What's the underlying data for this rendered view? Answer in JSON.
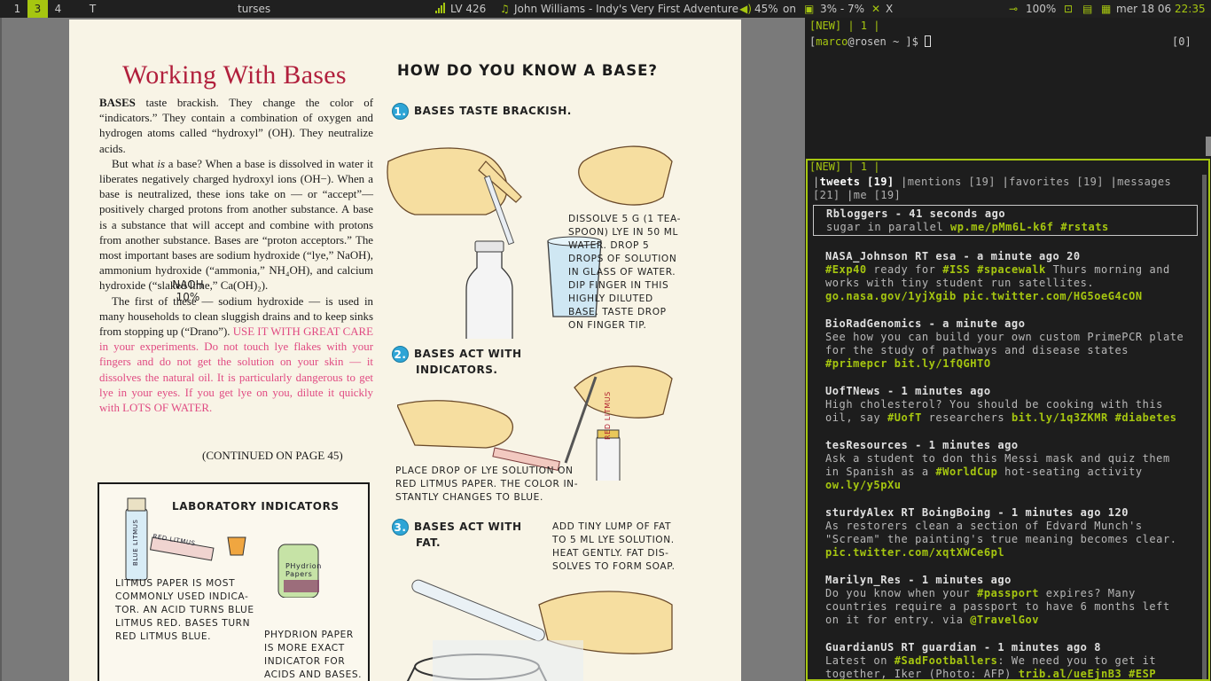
{
  "topbar": {
    "workspaces": [
      "1",
      "3",
      "4",
      "T"
    ],
    "active_workspace": "3",
    "window_title": "turses",
    "volume_label": "LV 426",
    "now_playing": "John Williams - Indy's Very First Adventure",
    "volume": "45%",
    "volume_state": "on",
    "cpu": "3% - 7%",
    "close_glyph": "X",
    "battery": "100%",
    "date": "mer 18 06",
    "time": "22:35",
    "accent": "#a6c610"
  },
  "pdf": {
    "title": "Working With Bases",
    "body_p1_lead": "BASES",
    "body_p1": " taste brackish. They change the color of “indicators.” They contain a combination of oxygen and hydrogen atoms called “hydroxyl” (OH). They neutralize acids.",
    "body_p2_a": "But what ",
    "body_p2_em": "is",
    "body_p2_b": " a base? When a base is dissolved in water it liberates negatively charged hydroxyl ions (OH−). When a base is neutralized, these ions take on — or “accept”— positively charged protons from another substance. A base is a substance that will accept and combine with protons from another substance. Bases are “proton acceptors.” The most important bases are sodium hydroxide (“lye,” NaOH), ammonium hydroxide (“ammonia,” NH₄OH), and calcium hydroxide (“slaked lime,” Ca(OH)₂).",
    "body_p3": "The first of these — sodium hydroxide — is used in many households to clean sluggish drains and to keep sinks from stopping up (“Drano”). ",
    "body_p3_warning": "USE IT WITH GREAT CARE in your experiments. Do not touch lye flakes with your fingers and do not get the solution on your skin — it dissolves the natural oil. It is particularly dangerous to get lye in your eyes. If you get lye on you, dilute it quickly with LOTS OF WATER.",
    "continued": "(CONTINUED ON PAGE 45)",
    "right_heading": "HOW DO YOU KNOW A BASE?",
    "step1_num": "1.",
    "step1": "BASES TASTE BRACKISH.",
    "step1_caption": [
      "DISSOLVE 5 g (1 TEA-",
      "SPOON) LYE IN 50 ml",
      "WATER. DROP 5",
      "DROPS OF SOLUTION",
      "IN GLASS OF WATER.",
      "DIP FINGER IN THIS",
      "HIGHLY DILUTED",
      "BASE. TASTE DROP",
      "ON FINGER TIP."
    ],
    "bottle_label": [
      "NaOH",
      "10%"
    ],
    "step2_num": "2.",
    "step2": [
      "BASES ACT WITH",
      "INDICATORS."
    ],
    "step2_caption": [
      "PLACE DROP OF LYE SOLUTION ON",
      "RED LITMUS PAPER. THE COLOR IN-",
      "STANTLY CHANGES TO BLUE."
    ],
    "red_litmus_vial": "RED LITMUS",
    "step3_num": "3.",
    "step3": [
      "BASES ACT WITH",
      "FAT."
    ],
    "step3_caption": [
      "ADD TINY LUMP OF FAT",
      "TO 5 ml LYE SOLUTION.",
      "HEAT GENTLY. FAT DIS-",
      "SOLVES TO FORM SOAP."
    ],
    "lab_title": "LABORATORY INDICATORS",
    "blue_litmus": "BLUE LITMUS",
    "red_litmus": "RED LITMUS",
    "phydrion_label": [
      "PHydrion",
      "Papers"
    ],
    "litmus_caption": [
      "LITMUS PAPER IS MOST",
      "COMMONLY USED INDICA-",
      "TOR. AN ACID TURNS BLUE",
      "LITMUS RED. BASES TURN",
      "RED LITMUS BLUE."
    ],
    "phydrion_caption": [
      "pHYDRION PAPER",
      "IS MORE EXACT",
      "INDICATOR FOR",
      "ACIDS AND BASES."
    ]
  },
  "term_top": {
    "tag_line": "[NEW] | 1 |",
    "prompt_user": "marco",
    "prompt_host": "rosen",
    "prompt_path": "~",
    "prompt_suffix": "]$",
    "right_indicator": "[0]"
  },
  "turses": {
    "tag_line": "[NEW] | 1 |",
    "tabs": [
      {
        "label": "tweets [19]",
        "current": true
      },
      {
        "label": "mentions [19]",
        "current": false
      },
      {
        "label": "favorites [19]",
        "current": false
      },
      {
        "label": "messages [21]",
        "current": false
      },
      {
        "label": "me [19]",
        "current": false
      }
    ],
    "tweets": [
      {
        "header": "Rbloggers - 41 seconds ago",
        "parts": [
          [
            "t",
            "sugar in parallel "
          ],
          [
            "h",
            "wp.me/pMm6L-k6f"
          ],
          [
            "t",
            " "
          ],
          [
            "h",
            "#rstats"
          ]
        ],
        "selected": true
      },
      {
        "header": "NASA_Johnson RT esa - a minute ago 20",
        "parts": [
          [
            "h",
            "#Exp40"
          ],
          [
            "t",
            " ready for "
          ],
          [
            "h",
            "#ISS"
          ],
          [
            "t",
            " "
          ],
          [
            "h",
            "#spacewalk"
          ],
          [
            "t",
            " Thurs morning and works with tiny student run satellites. "
          ],
          [
            "h",
            "go.nasa.gov/1yjXgib"
          ],
          [
            "t",
            " "
          ],
          [
            "h",
            "pic.twitter.com/HG5oeG4cON"
          ]
        ]
      },
      {
        "header": "BioRadGenomics - a minute ago",
        "parts": [
          [
            "t",
            "See how you can build your own custom PrimePCR plate for the study of pathways and disease states "
          ],
          [
            "h",
            "#primepcr"
          ],
          [
            "t",
            " "
          ],
          [
            "h",
            "bit.ly/1fQGHTO"
          ]
        ]
      },
      {
        "header": "UofTNews - 1 minutes ago",
        "parts": [
          [
            "t",
            "High cholesterol? You should be cooking with this oil, say "
          ],
          [
            "h",
            "#UofT"
          ],
          [
            "t",
            " researchers "
          ],
          [
            "h",
            "bit.ly/1q3ZKMR"
          ],
          [
            "t",
            " "
          ],
          [
            "h",
            "#diabetes"
          ]
        ]
      },
      {
        "header": "tesResources - 1 minutes ago",
        "parts": [
          [
            "t",
            "Ask a student to don this Messi mask and quiz them in Spanish as a "
          ],
          [
            "h",
            "#WorldCup"
          ],
          [
            "t",
            " hot-seating activity "
          ],
          [
            "h",
            "ow.ly/y5pXu"
          ]
        ]
      },
      {
        "header": "sturdyAlex RT BoingBoing - 1 minutes ago 120",
        "parts": [
          [
            "t",
            "As restorers clean a section of Edvard Munch's \"Scream\" the painting's true meaning becomes clear. "
          ],
          [
            "h",
            "pic.twitter.com/xqtXWCe6pl"
          ]
        ]
      },
      {
        "header": "Marilyn_Res - 1 minutes ago",
        "parts": [
          [
            "t",
            "Do you know when your "
          ],
          [
            "h",
            "#passport"
          ],
          [
            "t",
            " expires?  Many countries require a passport to have 6 months left on it for entry. via "
          ],
          [
            "h",
            "@TravelGov"
          ]
        ]
      },
      {
        "header": "GuardianUS RT guardian - 1 minutes ago 8",
        "parts": [
          [
            "t",
            "Latest on "
          ],
          [
            "h",
            "#SadFootballers"
          ],
          [
            "t",
            ": We need you to get it together, Iker (Photo: AFP)  "
          ],
          [
            "h",
            "trib.al/ueEjnB3"
          ],
          [
            "t",
            " "
          ],
          [
            "h",
            "#ESP"
          ]
        ]
      }
    ]
  }
}
